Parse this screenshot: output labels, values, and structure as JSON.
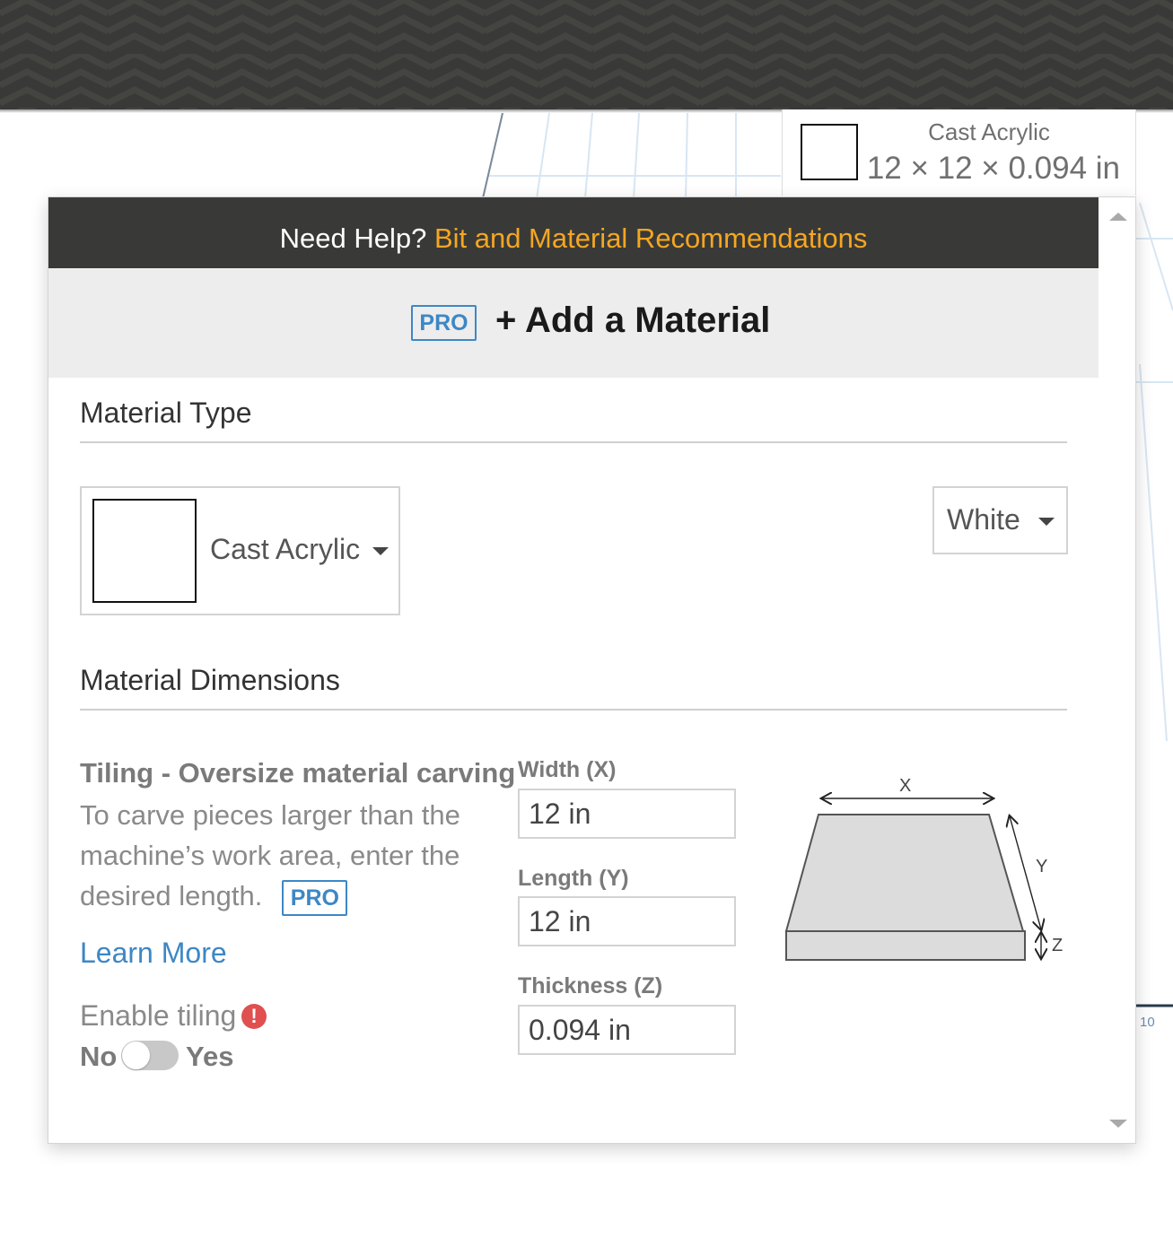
{
  "help_bar": {
    "prefix": "Need Help?",
    "link": "Bit and Material Recommendations"
  },
  "add_material": {
    "pro_badge": "PRO",
    "label": "+ Add a Material"
  },
  "summary_card": {
    "material_name": "Cast Acrylic",
    "dimensions": "12 × 12 × 0.094 in"
  },
  "material_type": {
    "section_title": "Material Type",
    "selected_material": "Cast Acrylic",
    "selected_color": "White"
  },
  "material_dimensions": {
    "section_title": "Material Dimensions",
    "tiling": {
      "title": "Tiling - Oversize material carving",
      "description": "To carve pieces larger than the machine’s work area, enter the desired length.",
      "pro_badge": "PRO",
      "learn_more": "Learn More",
      "enable_label": "Enable tiling",
      "warning_glyph": "!",
      "toggle_off_label": "No",
      "toggle_on_label": "Yes",
      "enabled": false
    },
    "fields": {
      "width": {
        "label": "Width (X)",
        "value": "12 in"
      },
      "length": {
        "label": "Length (Y)",
        "value": "12 in"
      },
      "thickness": {
        "label": "Thickness (Z)",
        "value": "0.094 in"
      }
    },
    "diagram": {
      "x_label": "X",
      "y_label": "Y",
      "z_label": "Z"
    }
  },
  "canvas": {
    "ruler_label": "10"
  },
  "colors": {
    "header_bg": "#393a37",
    "accent_link": "#f5a623",
    "pro_blue": "#3d87c5",
    "warning_red": "#e05050"
  }
}
